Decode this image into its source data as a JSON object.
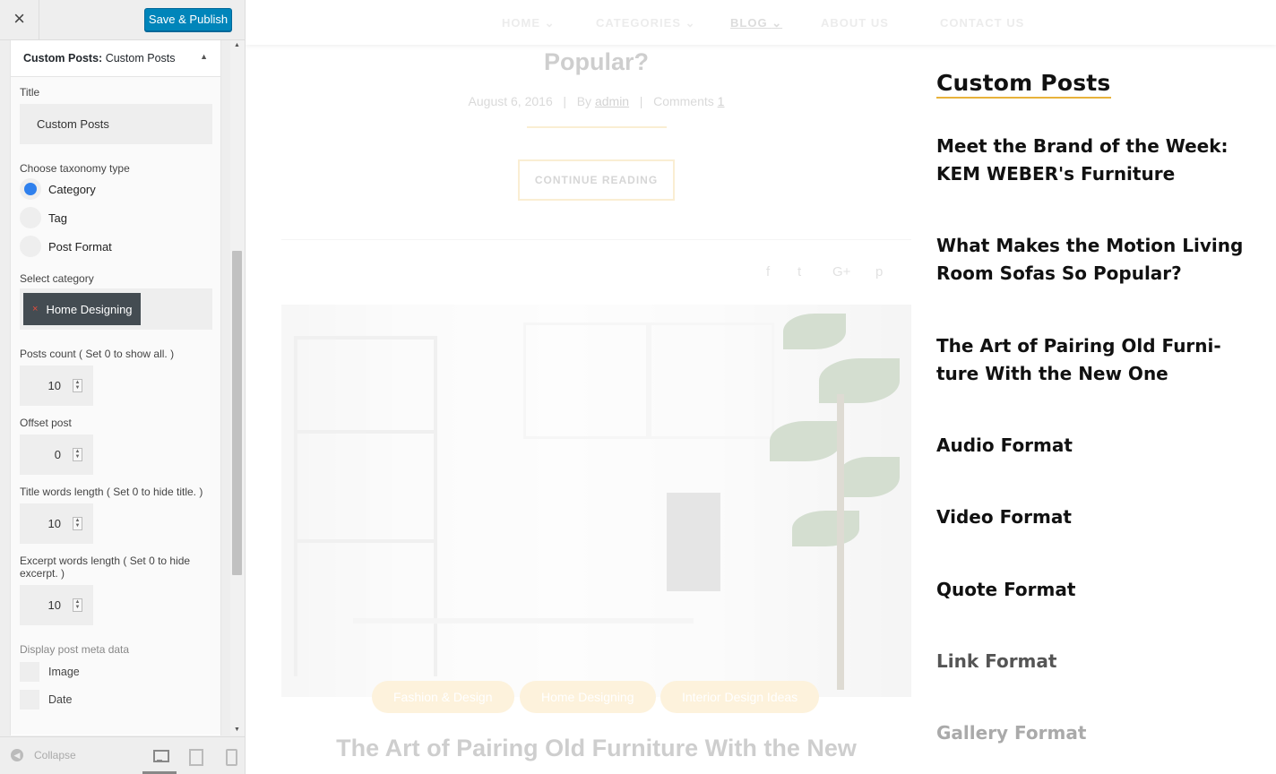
{
  "customizer": {
    "close_glyph": "×",
    "publish_label": "Save & Publish",
    "widget_title_prefix": "Custom Posts:",
    "widget_title_name": "Custom Posts",
    "title_label": "Title",
    "title_value": "Custom Posts",
    "taxonomy_label": "Choose taxonomy type",
    "taxonomy_options": [
      "Category",
      "Tag",
      "Post Format"
    ],
    "taxonomy_selected": "Category",
    "category_label": "Select category",
    "category_chip_remove": "×",
    "category_chip": "Home Designing",
    "posts_count_label": "Posts count ( Set 0 to show all. )",
    "posts_count": "10",
    "offset_label": "Offset post",
    "offset_value": "0",
    "title_words_label": "Title words length ( Set 0 to hide title. )",
    "title_words": "10",
    "excerpt_words_label": "Excerpt words length ( Set 0 to hide excerpt. )",
    "excerpt_words": "10",
    "meta_label": "Display post meta data",
    "meta_options": [
      "Image",
      "Date"
    ],
    "collapse_label": "Collapse"
  },
  "preview": {
    "nav": [
      "HOME",
      "CATEGORIES",
      "BLOG",
      "ABOUT US",
      "CONTACT US"
    ],
    "nav_chevron": "⌄",
    "active_nav": "BLOG",
    "post_title": "Popular?",
    "post_date": "August 6, 2016",
    "post_by_label": "By",
    "post_author": "admin",
    "post_comments_label": "Comments",
    "post_comments_count": "1",
    "continue_label": "CONTINUE READING",
    "share_icons": [
      "f",
      "t",
      "G+",
      "p"
    ],
    "tags": [
      "Fashion & Design",
      "Home Designing",
      "Interior Design Ideas"
    ],
    "next_title": "The Art of Pairing Old Furniture With the New",
    "widget_heading": "Custom Posts",
    "widget_posts": [
      "Meet the Brand of the Week: KEM WEBER's Furniture",
      "What Makes the Motion Living Room Sofas So Popular?",
      "The Art of Pairing Old Furni-ture With the New One",
      "Audio Format",
      "Video Format",
      "Quote Format",
      "Link Format",
      "Gallery Format"
    ]
  },
  "colors": {
    "publish_blue": "#0085ba",
    "accent_gold": "#e8b23a",
    "chip_dark": "#444c52",
    "radio_blue": "#2f80ed"
  }
}
